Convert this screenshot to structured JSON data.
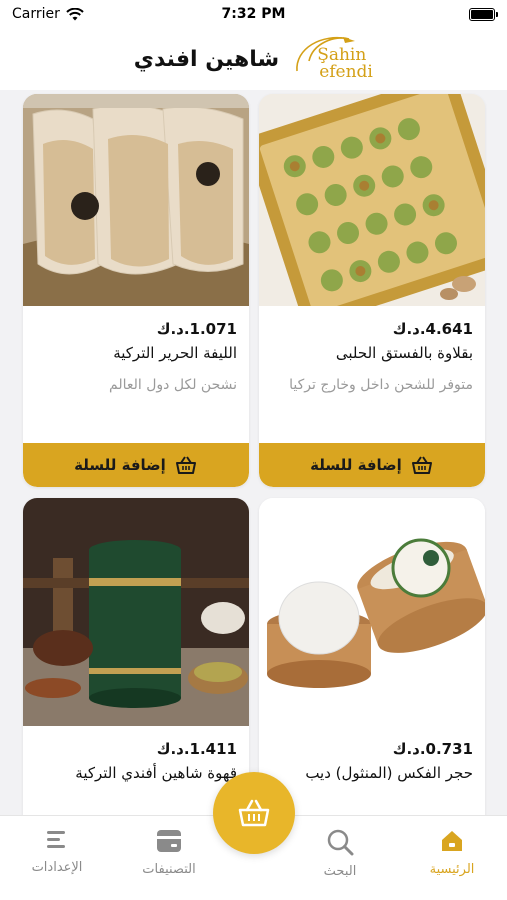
{
  "status_bar": {
    "carrier": "Carrier",
    "time": "7:32 PM"
  },
  "header": {
    "title": "شاهين افندي",
    "logo_line1": "Şahin",
    "logo_line2": "efendi"
  },
  "products": [
    {
      "price": "4.641.د.ك",
      "name": "بقلاوة بالفستق الحلبى",
      "note": "متوفر للشحن داخل وخارج تركيا",
      "button": "إضافة للسلة"
    },
    {
      "price": "1.071.د.ك",
      "name": "الليفة الحرير التركية",
      "note": "نشحن لكل دول العالم",
      "button": "إضافة للسلة"
    },
    {
      "price": "0.731.د.ك",
      "name": "حجر الفكس (المنثول) ديب",
      "note": "",
      "button": ""
    },
    {
      "price": "1.411.د.ك",
      "name": "قهوة شاهين أفندي التركية",
      "note": "",
      "button": ""
    }
  ],
  "tabs": [
    {
      "label": "الرئيسية",
      "icon": "home-icon"
    },
    {
      "label": "البحث",
      "icon": "search-icon"
    },
    {
      "label": "التصنيفات",
      "icon": "categories-icon"
    },
    {
      "label": "الإعدادات",
      "icon": "settings-icon"
    }
  ],
  "colors": {
    "accent": "#d9a520",
    "fab": "#e8b62a",
    "inactive": "#8a8a8a"
  }
}
